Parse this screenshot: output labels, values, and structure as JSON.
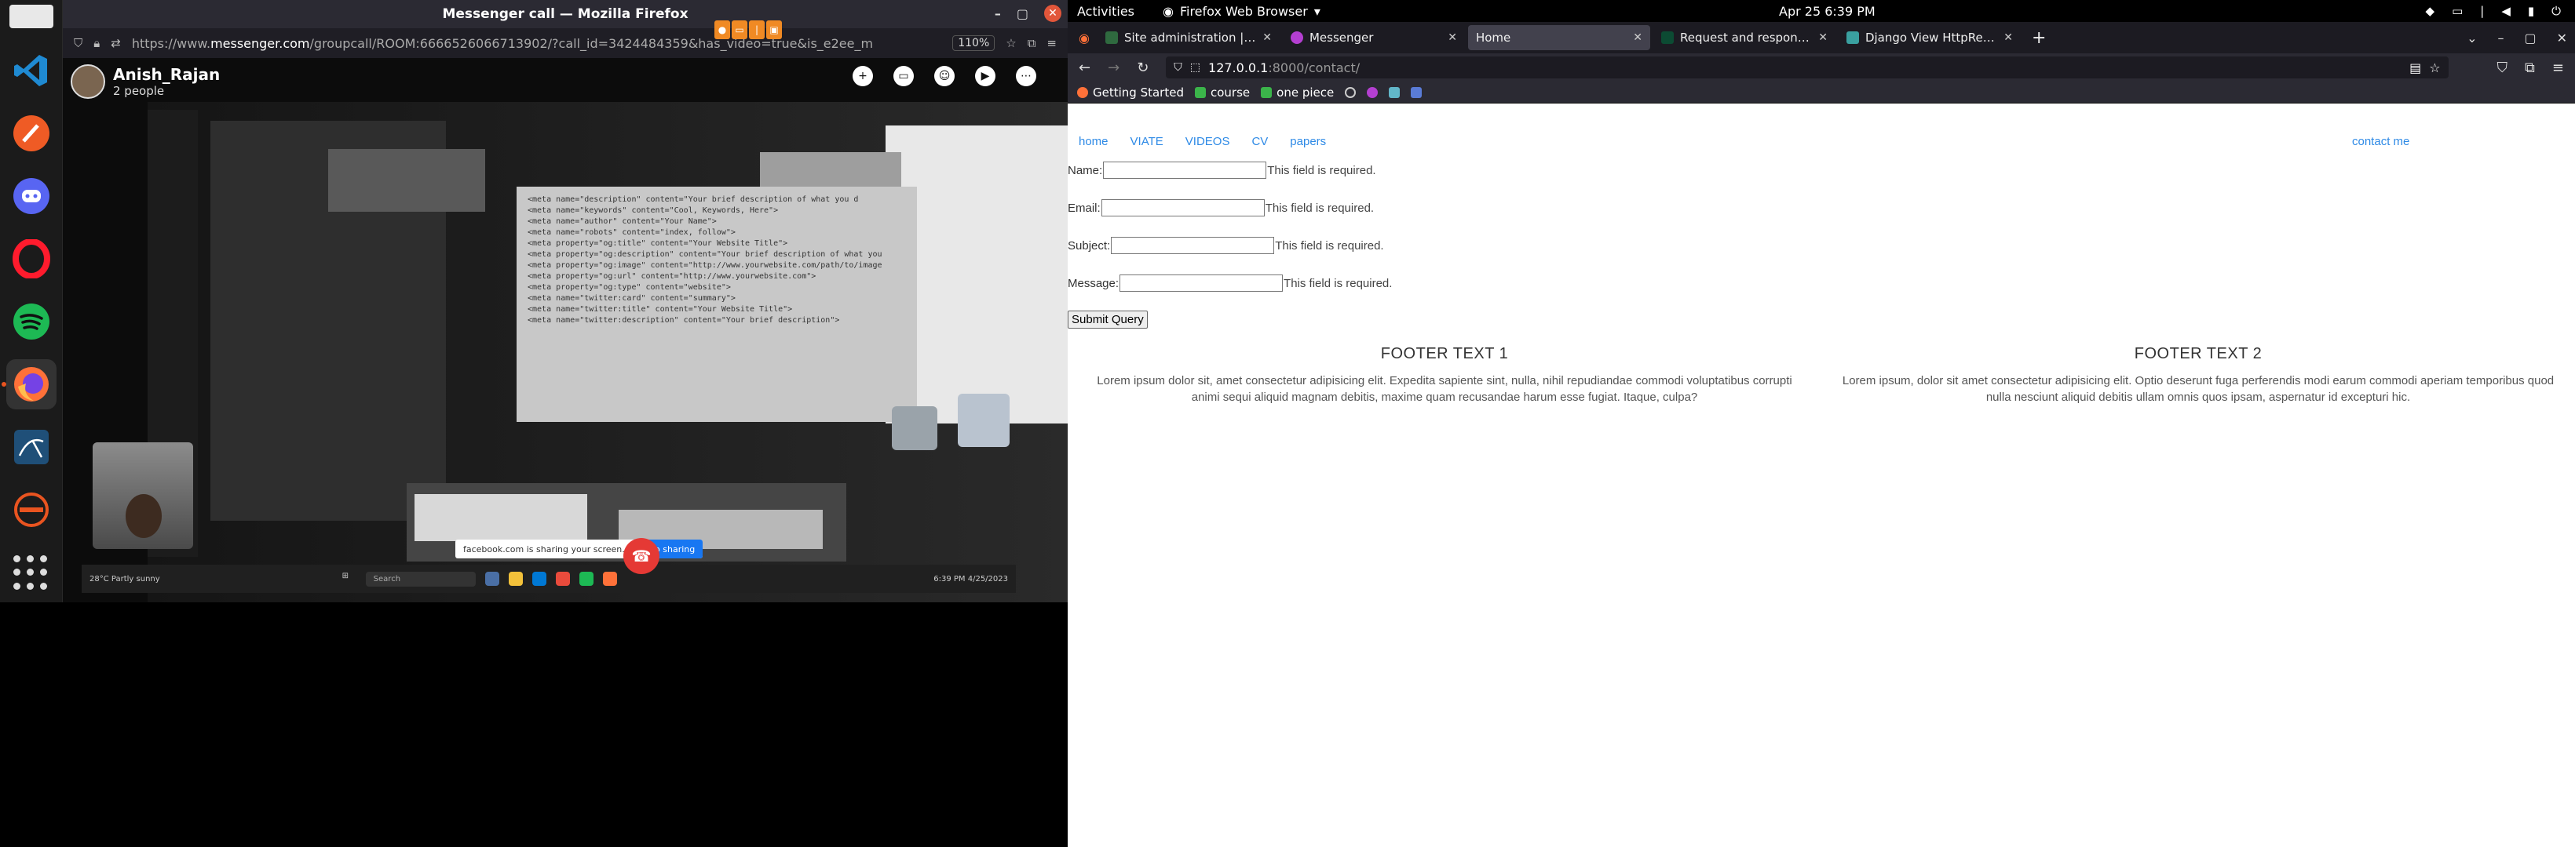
{
  "topbar": {
    "activities": "Activities",
    "app": "Firefox Web Browser",
    "clock": "Apr 25   6:39 PM"
  },
  "messenger_window": {
    "title": "Messenger call — Mozilla Firefox",
    "url_prefix": "https://www.",
    "url_domain": "messenger.com",
    "url_rest": "/groupcall/ROOM:6666526066713902/?call_id=3424484359&has_video=true&is_e2ee_m",
    "zoom": "110%",
    "caller_name": "Anish_Rajan",
    "people_count": "2 people",
    "share_notice": "facebook.com is sharing your screen.",
    "share_button": "Stop sharing",
    "taskbar_search": "Search",
    "taskbar_weather": "28°C",
    "taskbar_weather_sub": "Partly sunny",
    "taskbar_time": "6:39 PM",
    "taskbar_date": "4/25/2023",
    "code_lines": [
      "<meta name=\"description\" content=\"Your brief description of what you d",
      "<meta name=\"keywords\" content=\"Cool, Keywords, Here\">",
      "<meta name=\"author\" content=\"Your Name\">",
      "<meta name=\"robots\" content=\"index, follow\">",
      "<meta property=\"og:title\" content=\"Your Website Title\">",
      "<meta property=\"og:description\" content=\"Your brief description of what you",
      "<meta property=\"og:image\" content=\"http://www.yourwebsite.com/path/to/image",
      "<meta property=\"og:url\" content=\"http://www.yourwebsite.com\">",
      "<meta property=\"og:type\" content=\"website\">",
      "<meta name=\"twitter:card\" content=\"summary\">",
      "<meta name=\"twitter:title\" content=\"Your Website Title\">",
      "<meta name=\"twitter:description\" content=\"Your brief description\">"
    ]
  },
  "browser": {
    "tabs": [
      {
        "label": "Site administration | Django",
        "color": "#2f6a3f"
      },
      {
        "label": "Messenger",
        "color": "#b43fd1"
      },
      {
        "label": "Home",
        "color": "#9b9b9b"
      },
      {
        "label": "Request and response obj",
        "color": "#0c4b33"
      },
      {
        "label": "Django View HttpRespons",
        "color": "#3aa0a0"
      }
    ],
    "url_host": "127.0.0.1",
    "url_path": ":8000/contact/",
    "bookmarks": [
      "Getting Started",
      "course",
      "one piece"
    ]
  },
  "page": {
    "nav": [
      "home",
      "VIATE",
      "VIDEOS",
      "CV",
      "papers"
    ],
    "contact": "contact me",
    "fields": [
      {
        "label": "Name:",
        "error": "This field is required."
      },
      {
        "label": "Email:",
        "error": "This field is required."
      },
      {
        "label": "Subject:",
        "error": "This field is required."
      },
      {
        "label": "Message:",
        "error": "This field is required."
      }
    ],
    "submit": "Submit Query",
    "footer1_title": "FOOTER TEXT 1",
    "footer1_text": "Lorem ipsum dolor sit, amet consectetur adipisicing elit. Expedita sapiente sint, nulla, nihil repudiandae commodi voluptatibus corrupti animi sequi aliquid magnam debitis, maxime quam recusandae harum esse fugiat. Itaque, culpa?",
    "footer2_title": "FOOTER TEXT 2",
    "footer2_text": "Lorem ipsum, dolor sit amet consectetur adipisicing elit. Optio deserunt fuga perferendis modi earum commodi aperiam temporibus quod nulla nesciunt aliquid debitis ullam omnis quos ipsam, aspernatur id excepturi hic."
  }
}
